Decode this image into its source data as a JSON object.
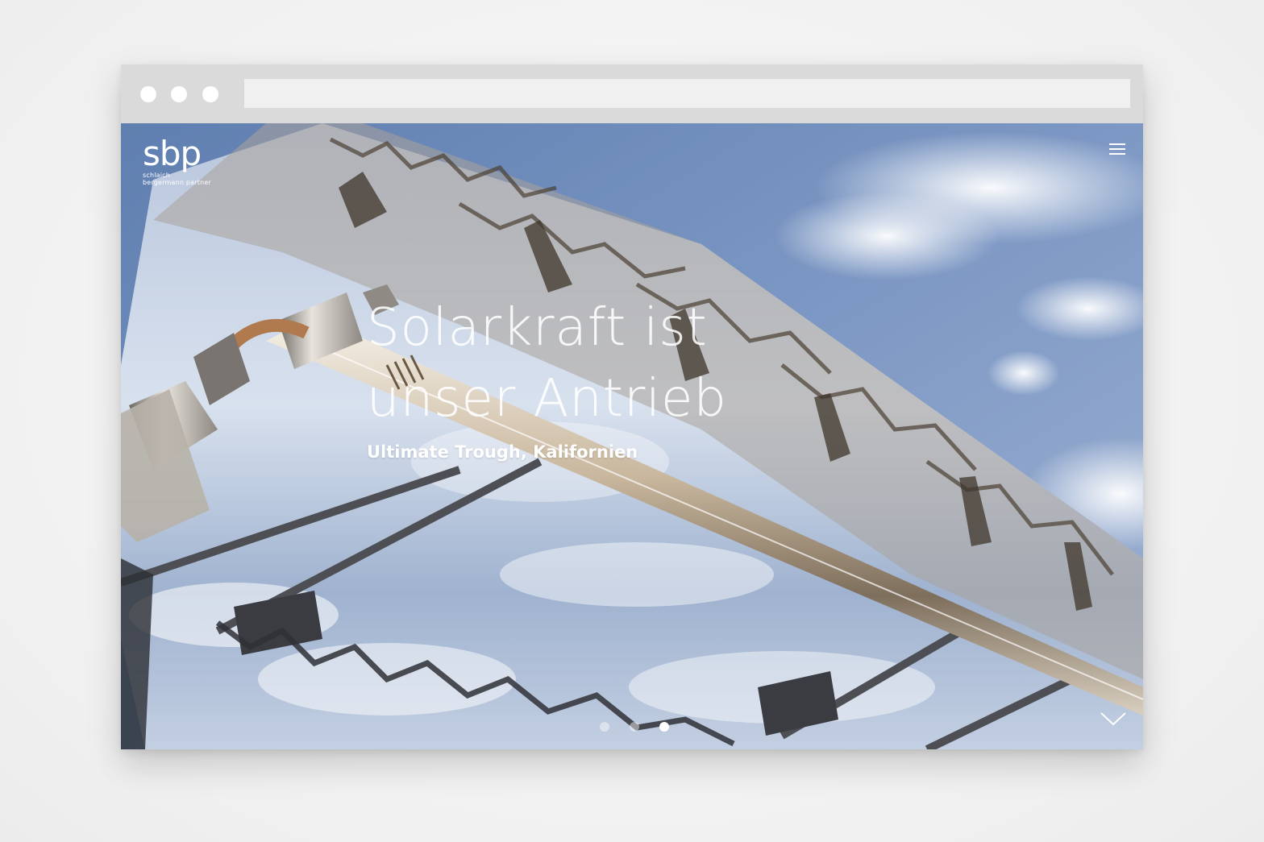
{
  "browser": {
    "address_value": ""
  },
  "site": {
    "logo_mark": "sbp",
    "logo_line1": "schlaich",
    "logo_line2": "bergermann partner"
  },
  "hero": {
    "headline_line1": "Solarkraft ist",
    "headline_line2": "unser Antrieb",
    "subtitle": "Ultimate Trough, Kalifornien",
    "slides_total": 3,
    "active_slide": 3
  },
  "icons": {
    "menu": "hamburger-menu-icon",
    "scroll": "chevron-down-icon"
  },
  "colors": {
    "chrome": "#dadada",
    "address_bar": "#f0f0f0",
    "text": "#ffffff",
    "sky": "#8fa6c9"
  }
}
